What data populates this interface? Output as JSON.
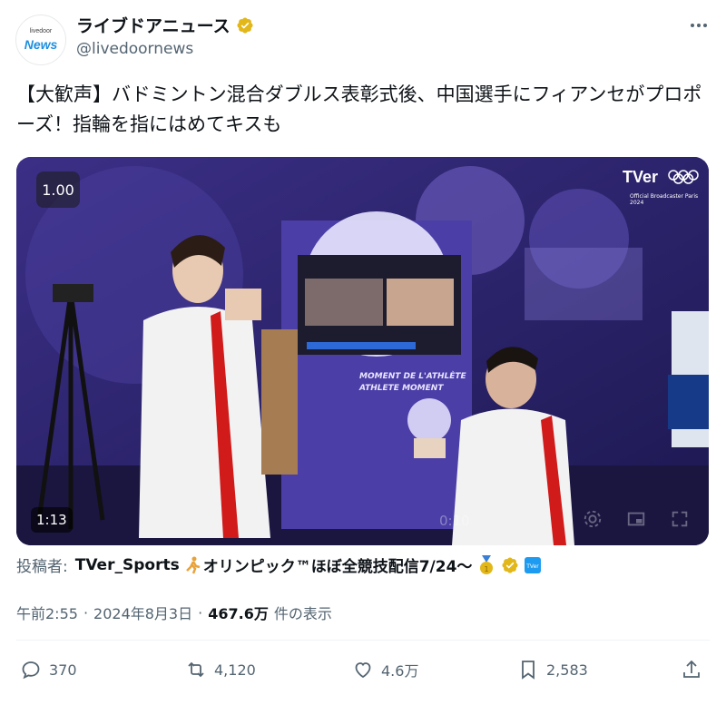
{
  "author": {
    "avatar_top_text": "livedoor",
    "avatar_main_text": "News",
    "display_name": "ライブドアニュース",
    "handle": "@livedoornews",
    "verified_icon": "gold-verified-badge-icon",
    "verified_color": "#e2b719"
  },
  "tweet": {
    "text": "【大歓声】バドミントン混合ダブルス表彰式後、中国選手にフィアンセがプロポーズ！指輪を指にはめてキスも"
  },
  "media": {
    "speed": "1.00",
    "duration": "1:13",
    "elapsed_overlay": "0:10",
    "watermark": "TVer",
    "watermark_sub": "Official Broadcaster Paris 2024",
    "screen_sign_line1": "MOMENT DE L'ATHLÈTE",
    "screen_sign_line2": "ATHLETE MOMENT"
  },
  "attribution": {
    "label": "投稿者:",
    "source": "TVer_Sports",
    "source_suffix": "オリンピック™ほぼ全競技配信7/24〜"
  },
  "meta": {
    "time": "午前2:55",
    "date": "2024年8月3日",
    "views_count": "467.6万",
    "views_label": "件の表示"
  },
  "actions": {
    "reply_count": "370",
    "retweet_count": "4,120",
    "like_count": "4.6万",
    "bookmark_count": "2,583"
  },
  "colors": {
    "text_primary": "#0f1419",
    "text_secondary": "#536471",
    "accent": "#1d9bf0"
  }
}
